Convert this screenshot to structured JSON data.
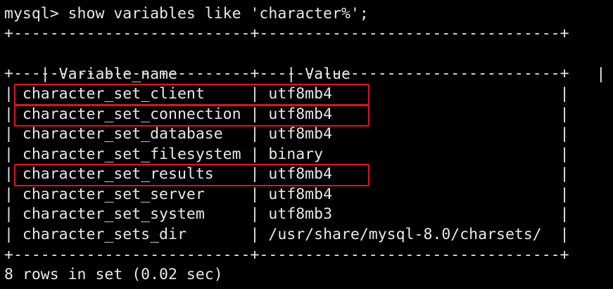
{
  "terminal": {
    "command": "mysql> show variables like 'character%';",
    "border_top": "+--------------------------+---------------------------------+",
    "header": {
      "col1": "Variable_name",
      "col2": "Value"
    },
    "border_mid": "+--------------------------+---------------------------------+",
    "rows": [
      {
        "name": "character_set_client",
        "value": "utf8mb4",
        "highlighted": true
      },
      {
        "name": "character_set_connection",
        "value": "utf8mb4",
        "highlighted": true
      },
      {
        "name": "character_set_database",
        "value": "utf8mb4",
        "highlighted": false
      },
      {
        "name": "character_set_filesystem",
        "value": "binary",
        "highlighted": false
      },
      {
        "name": "character_set_results",
        "value": "utf8mb4",
        "highlighted": true
      },
      {
        "name": "character_set_server",
        "value": "utf8mb4",
        "highlighted": false
      },
      {
        "name": "character_set_system",
        "value": "utf8mb3",
        "highlighted": false
      },
      {
        "name": "character_sets_dir",
        "value": "/usr/share/mysql-8.0/charsets/",
        "highlighted": false
      }
    ],
    "border_bottom": "+--------------------------+---------------------------------+",
    "footer": "8 rows in set (0.02 sec)"
  },
  "colors": {
    "background": "#000000",
    "text": "#e8e8e8",
    "highlight": "#e0141e"
  }
}
